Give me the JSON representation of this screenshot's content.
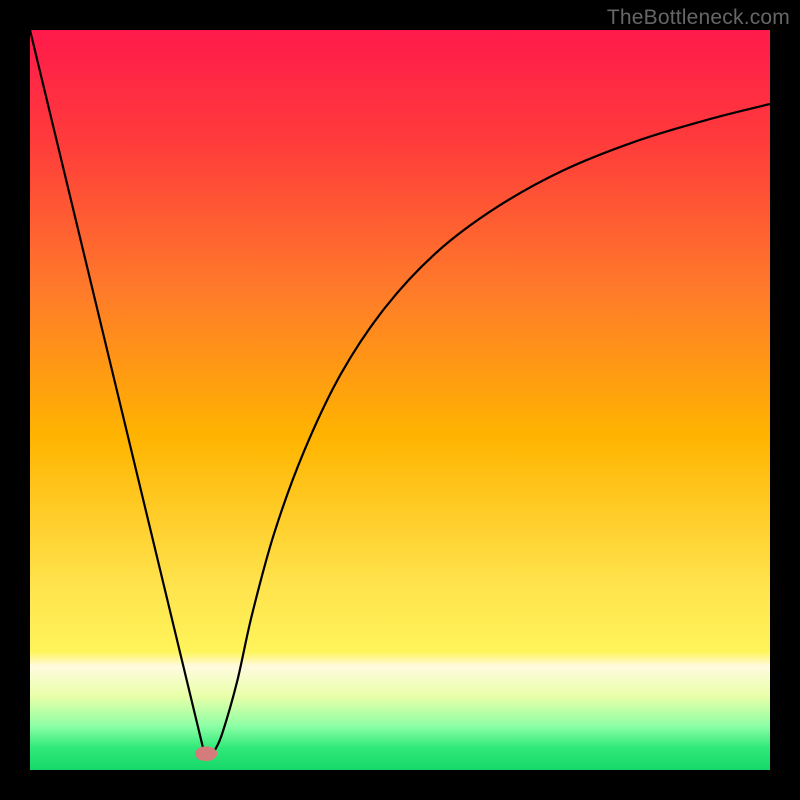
{
  "attribution": "TheBottleneck.com",
  "chart_data": {
    "type": "line",
    "title": "",
    "xlabel": "",
    "ylabel": "",
    "xlim": [
      0,
      100
    ],
    "ylim": [
      0,
      100
    ],
    "gradient_stops": [
      {
        "offset": 0.0,
        "color": "#ff1a4b"
      },
      {
        "offset": 0.15,
        "color": "#ff3b3b"
      },
      {
        "offset": 0.35,
        "color": "#ff7a2a"
      },
      {
        "offset": 0.55,
        "color": "#ffb400"
      },
      {
        "offset": 0.75,
        "color": "#ffe34d"
      },
      {
        "offset": 0.84,
        "color": "#fff45a"
      },
      {
        "offset": 0.86,
        "color": "#fffbe0"
      },
      {
        "offset": 0.9,
        "color": "#e9ffa8"
      },
      {
        "offset": 0.94,
        "color": "#8effa6"
      },
      {
        "offset": 0.97,
        "color": "#30e97a"
      },
      {
        "offset": 1.0,
        "color": "#16d86a"
      }
    ],
    "left_segment": {
      "x": [
        0,
        23.5
      ],
      "y": [
        100,
        2.5
      ]
    },
    "right_curve": {
      "x": [
        25,
        26,
        28,
        30,
        33,
        37,
        42,
        48,
        55,
        63,
        72,
        82,
        92,
        100
      ],
      "y": [
        2.7,
        5,
        12,
        21,
        32,
        43,
        53.5,
        62.5,
        70,
        76,
        81,
        85,
        88,
        90
      ]
    },
    "marker": {
      "x": 23.8,
      "y": 2.2,
      "rx": 1.5,
      "ry": 1.0,
      "color": "#d47b7b"
    }
  }
}
